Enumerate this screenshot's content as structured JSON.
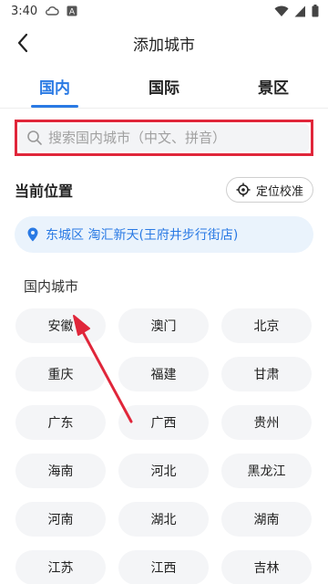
{
  "status_bar": {
    "time": "3:40",
    "icons": [
      "cloud-icon",
      "a-notification-icon",
      "wifi-icon",
      "signal-icon",
      "battery-icon"
    ]
  },
  "nav": {
    "title": "添加城市",
    "back_icon": "chevron-left-icon"
  },
  "tabs": [
    {
      "label": "国内",
      "active": true
    },
    {
      "label": "国际",
      "active": false
    },
    {
      "label": "景区",
      "active": false
    }
  ],
  "search": {
    "placeholder": "搜索国内城市（中文、拼音）",
    "value": "",
    "icon": "search-icon"
  },
  "current_location": {
    "title": "当前位置",
    "locate_button_label": "定位校准",
    "locate_icon": "crosshair-icon",
    "location_text": "东城区 淘汇新天(王府井步行街店)",
    "location_icon": "map-pin-icon"
  },
  "domestic_cities": {
    "title": "国内城市",
    "cities": [
      "安徽",
      "澳门",
      "北京",
      "重庆",
      "福建",
      "甘肃",
      "广东",
      "广西",
      "贵州",
      "海南",
      "河北",
      "黑龙江",
      "河南",
      "湖北",
      "湖南",
      "江苏",
      "江西",
      "吉林"
    ]
  },
  "colors": {
    "accent": "#2a7ae4",
    "highlight_box": "#e0263a",
    "annotation_arrow": "#e0263a"
  }
}
